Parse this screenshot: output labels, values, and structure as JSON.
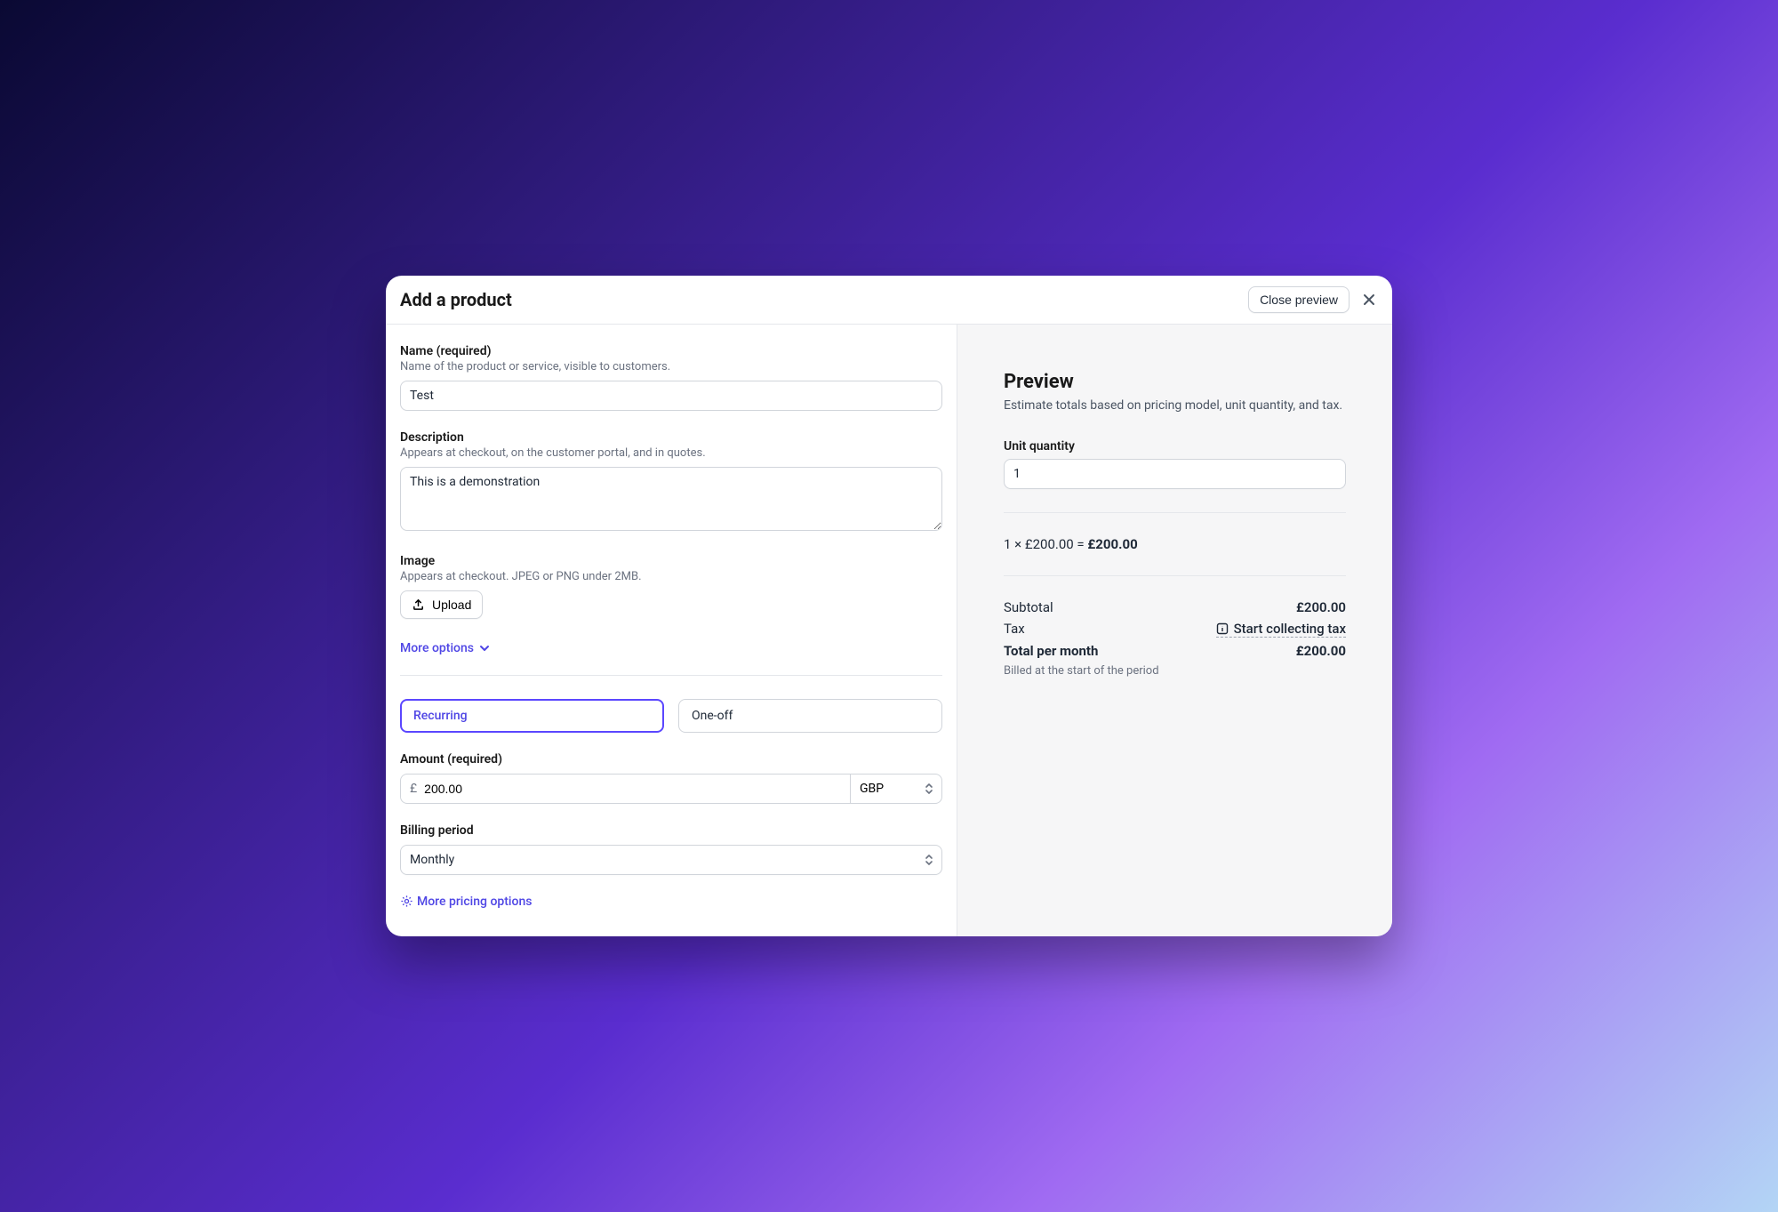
{
  "header": {
    "title": "Add a product",
    "close_preview": "Close preview"
  },
  "name": {
    "label": "Name (required)",
    "help": "Name of the product or service, visible to customers.",
    "value": "Test"
  },
  "description": {
    "label": "Description",
    "help": "Appears at checkout, on the customer portal, and in quotes.",
    "value": "This is a demonstration"
  },
  "image": {
    "label": "Image",
    "help": "Appears at checkout. JPEG or PNG under 2MB.",
    "upload": "Upload"
  },
  "more_options": "More options",
  "billing_type": {
    "recurring": "Recurring",
    "one_off": "One-off"
  },
  "amount": {
    "label": "Amount (required)",
    "prefix": "£",
    "value": "200.00",
    "currency": "GBP"
  },
  "billing_period": {
    "label": "Billing period",
    "value": "Monthly"
  },
  "more_pricing": "More pricing options",
  "preview": {
    "title": "Preview",
    "help": "Estimate totals based on pricing model, unit quantity, and tax.",
    "unit_quantity_label": "Unit quantity",
    "unit_quantity_value": "1",
    "calc_line_prefix": "1 × £200.00 = ",
    "calc_line_total": "£200.00",
    "subtotal_label": "Subtotal",
    "subtotal_value": "£200.00",
    "tax_label": "Tax",
    "tax_action": "Start collecting tax",
    "total_label": "Total per month",
    "total_value": "£200.00",
    "billed_note": "Billed at the start of the period"
  }
}
